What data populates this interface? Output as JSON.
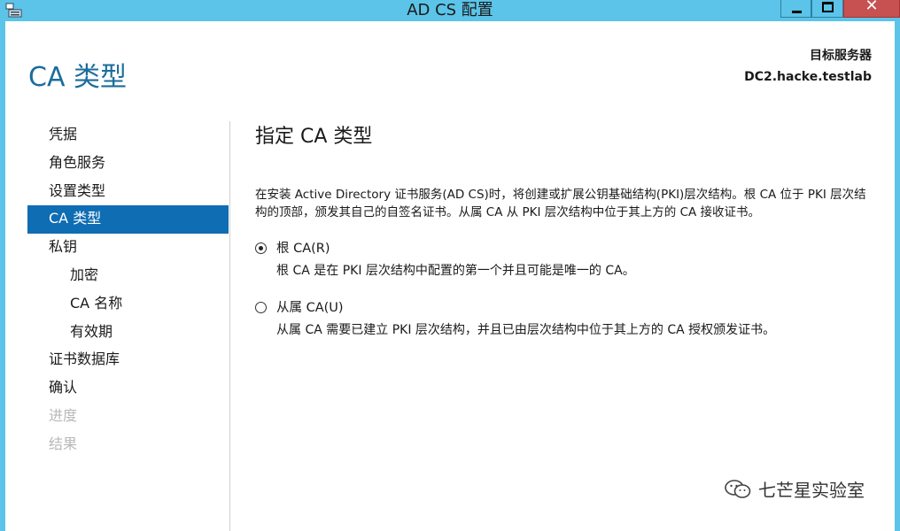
{
  "window": {
    "title": "AD CS 配置",
    "close_glyph": "✕"
  },
  "header": {
    "page_title": "CA 类型",
    "server_label": "目标服务器",
    "server_name": "DC2.hacke.testlab"
  },
  "nav": {
    "items": [
      {
        "label": "凭据",
        "state": "normal"
      },
      {
        "label": "角色服务",
        "state": "normal"
      },
      {
        "label": "设置类型",
        "state": "normal"
      },
      {
        "label": "CA 类型",
        "state": "active"
      },
      {
        "label": "私钥",
        "state": "normal"
      },
      {
        "label": "加密",
        "state": "sub"
      },
      {
        "label": "CA 名称",
        "state": "sub"
      },
      {
        "label": "有效期",
        "state": "sub"
      },
      {
        "label": "证书数据库",
        "state": "normal"
      },
      {
        "label": "确认",
        "state": "normal"
      },
      {
        "label": "进度",
        "state": "disabled"
      },
      {
        "label": "结果",
        "state": "disabled"
      }
    ]
  },
  "main": {
    "section_title": "指定 CA 类型",
    "description": "在安装 Active Directory 证书服务(AD CS)时，将创建或扩展公钥基础结构(PKI)层次结构。根 CA 位于 PKI 层次结构的顶部，颁发其自己的自签名证书。从属 CA 从 PKI 层次结构中位于其上方的 CA 接收证书。",
    "options": [
      {
        "label": "根 CA(R)",
        "description": "根 CA 是在 PKI 层次结构中配置的第一个并且可能是唯一的 CA。",
        "selected": true
      },
      {
        "label": "从属 CA(U)",
        "description": "从属 CA 需要已建立 PKI 层次结构，并且已由层次结构中位于其上方的 CA 授权颁发证书。",
        "selected": false
      }
    ]
  },
  "watermark": {
    "text": "七芒星实验室"
  },
  "colors": {
    "titlebar": "#5bc4e8",
    "accent": "#0e6db3",
    "page_title": "#1b6d9b",
    "disabled": "#b8b8b8"
  }
}
